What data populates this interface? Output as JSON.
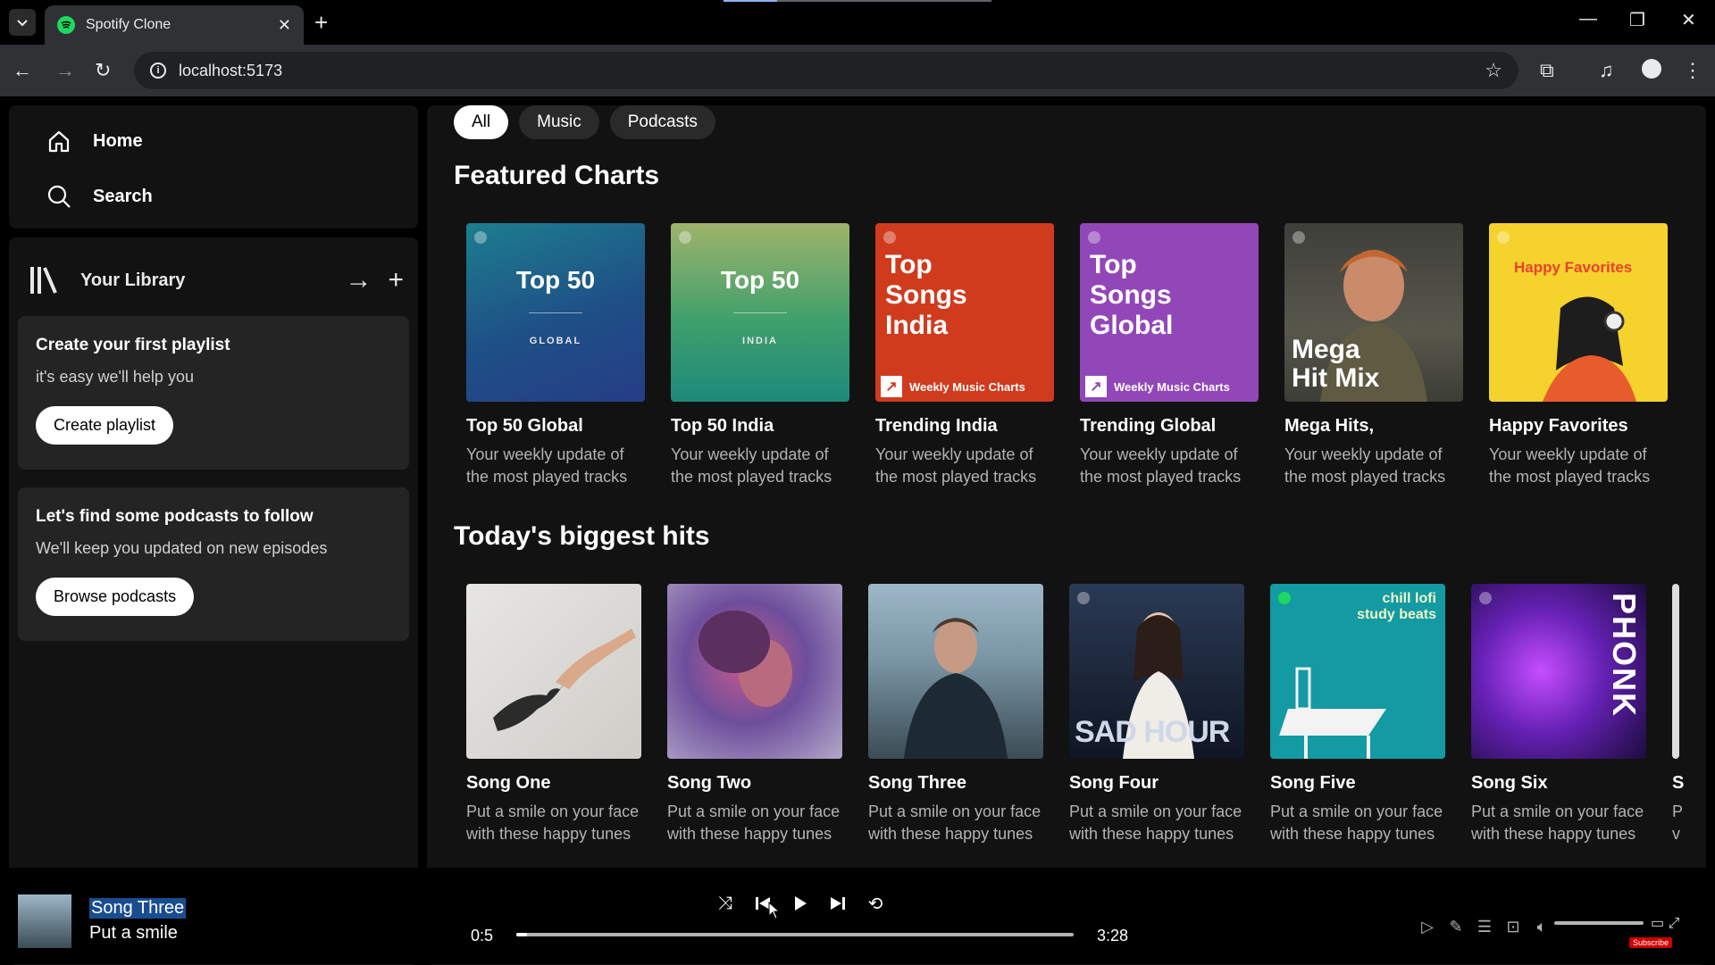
{
  "browser": {
    "tab_title": "Spotify Clone",
    "url": "localhost:5173"
  },
  "sidebar": {
    "home_label": "Home",
    "search_label": "Search",
    "library_title": "Your Library",
    "playlist_card": {
      "title": "Create your first playlist",
      "subtitle": "it's easy we'll help you",
      "button": "Create playlist"
    },
    "podcast_card": {
      "title": "Let's find some podcasts to follow",
      "subtitle": "We'll keep you updated on new episodes",
      "button": "Browse podcasts"
    }
  },
  "filters": [
    "All",
    "Music",
    "Podcasts"
  ],
  "featured": {
    "title": "Featured Charts",
    "items": [
      {
        "title": "Top 50 Global",
        "desc": "Your weekly update of the most played tracks",
        "cover_title": "Top 50",
        "cover_sub": "GLOBAL"
      },
      {
        "title": "Top 50 India",
        "desc": "Your weekly update of the most played tracks",
        "cover_title": "Top 50",
        "cover_sub": "INDIA"
      },
      {
        "title": "Trending India",
        "desc": "Your weekly update of the most played tracks",
        "cover_title": "Top Songs India",
        "cover_badge": "Weekly Music Charts"
      },
      {
        "title": "Trending Global",
        "desc": "Your weekly update of the most played tracks",
        "cover_title": "Top Songs Global",
        "cover_badge": "Weekly Music Charts"
      },
      {
        "title": "Mega Hits,",
        "desc": "Your weekly update of the most played tracks",
        "cover_title": "Mega Hit Mix"
      },
      {
        "title": "Happy Favorites",
        "desc": "Your weekly update of the most played tracks",
        "cover_title": "Happy Favorites"
      }
    ]
  },
  "hits": {
    "title": "Today's biggest hits",
    "items": [
      {
        "title": "Song One",
        "desc": "Put a smile on your face with these happy tunes"
      },
      {
        "title": "Song Two",
        "desc": "Put a smile on your face with these happy tunes"
      },
      {
        "title": "Song Three",
        "desc": "Put a smile on your face with these happy tunes"
      },
      {
        "title": "Song Four",
        "desc": "Put a smile on your face with these happy tunes",
        "cover_text": "SAD HOUR"
      },
      {
        "title": "Song Five",
        "desc": "Put a smile on your face with these happy tunes",
        "cover_text": "chill lofi study beats"
      },
      {
        "title": "Song Six",
        "desc": "Put a smile on your face with these happy tunes",
        "cover_text": "PHONK"
      },
      {
        "title": "S",
        "desc": "P v"
      }
    ]
  },
  "player": {
    "title": "Song Three",
    "artist": "Put a smile",
    "elapsed": "0:5",
    "duration": "3:28",
    "progress_fraction": 0.02,
    "subscribe_label": "Subscribe"
  }
}
